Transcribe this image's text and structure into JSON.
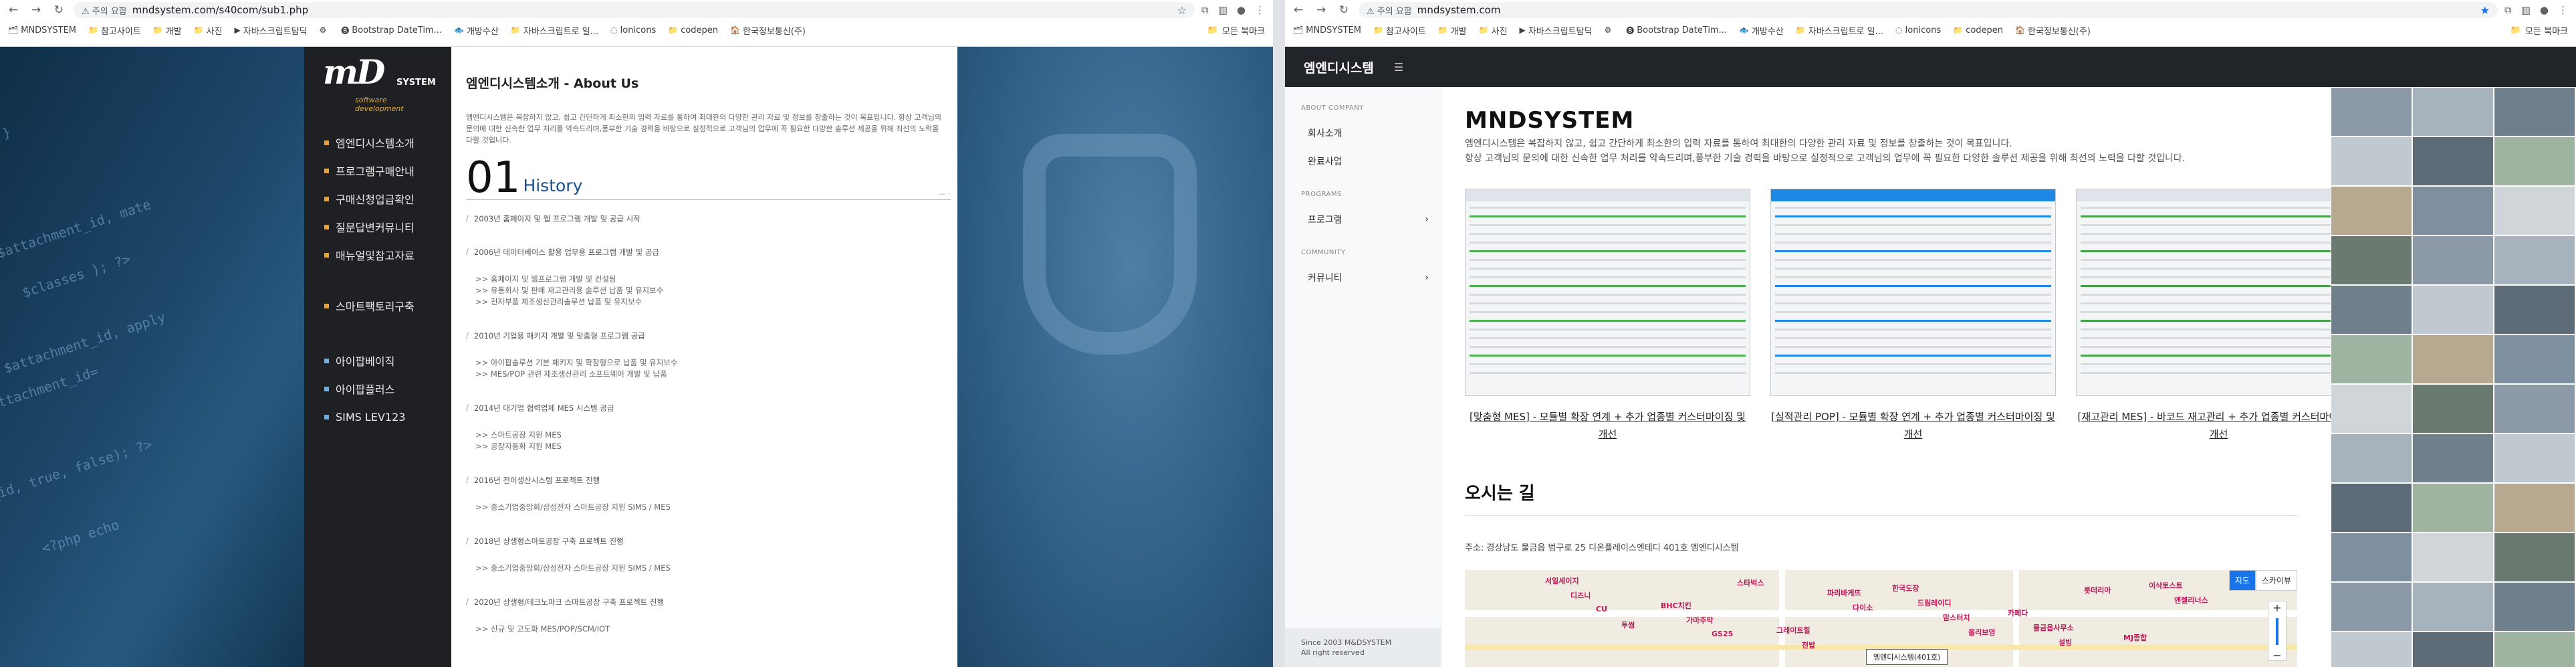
{
  "left": {
    "browser": {
      "security_label": "주의 요함",
      "url": "mndsystem.com/s40com/sub1.php",
      "bookmarks": [
        "MNDSYSTEM",
        "참고사이트",
        "개발",
        "사진",
        "자바스크립트탐딕",
        "",
        "Bootstrap DateTim...",
        "개방수산",
        "자바스크립트로 일...",
        "Ionicons",
        "codepen",
        "한국정보통신(주)"
      ],
      "bookmarks_right": "모든 북마크"
    },
    "logo": {
      "mark": "mD",
      "system": "SYSTEM",
      "tagline": "software development"
    },
    "menu": [
      "엠엔디시스템소개",
      "프로그램구매안내",
      "구매신청업급확인",
      "질문답변커뮤니티",
      "매뉴얼및참고자료"
    ],
    "menu_mid": [
      "스마트팩토리구축"
    ],
    "menu_low": [
      "아이팝베이직",
      "아이팝플러스",
      "SIMS LEV123"
    ],
    "page_title": "엠엔디시스템소개 - About Us",
    "intro": "엠엔디시스템은 복잡하지 않고, 쉽고 간단하게 최소한의 입력 자료를 통하여 최대한의 다양한 관리 자료 및 정보를 창출하는 것이 목표입니다. 항상 고객님의 문의에 대한 신속한 업무 처리를 약속드리며,풍부한 기술 경력을 바탕으로 실정적으로 고객님의 업무에 꼭 필요한 다양한 솔루션 제공을 위해 최선의 노력을 다할 것입니다.",
    "history_number": "01",
    "history_title": "History",
    "history_mark": "— ·",
    "history": [
      {
        "year": "2003년 홈페이지 및 웹 프로그램 개발 및 공급 시작",
        "items": []
      },
      {
        "year": "2006년 데이터베이스 활용 업무용 프로그램 개발 및 공급",
        "items": [
          ">> 홈페이지 및 웹프로그램 개발 및 컨설팅",
          ">> 유통회사 및 판매 재고관리용 솔루션 납품 및 유지보수",
          ">> 전자부품 제조생산관리솔루션 납품 및 유지보수"
        ]
      },
      {
        "year": "2010년 기업용 패키지 개발 및 맞춤형 프로그램 공급",
        "items": [
          ">> 아이팝솔루션 기본 패키지 및 확장형으로 납품 및 유지보수",
          ">> MES/POP 관련 제조생산관리 소프트웨어 개발 및 납품"
        ]
      },
      {
        "year": "2014년 대기업 협력업체 MES 시스템 공급",
        "items": [
          ">> 스마트공장 지원 MES",
          ">> 공장자동화 지원 MES"
        ]
      },
      {
        "year": "2016년 전이생산시스템 프로젝트 진행",
        "items": [
          ">> 중소기업중앙회/삼성전자 스마트공장 지원 SIMS / MES"
        ]
      },
      {
        "year": "2018년 상생형스마트공장 구축 프로젝트 진행",
        "items": [
          ">> 중소기업중앙회/삼성전자 스마트공장 지원 SIMS / MES"
        ]
      },
      {
        "year": "2020년 상생형/테크노파크 스마트공장 구축 프로젝트 진행",
        "items": [
          ">> 신규 및 고도화 MES/POP/SCM/IOT"
        ]
      }
    ]
  },
  "right": {
    "browser": {
      "security_label": "주의 요함",
      "url": "mndsystem.com",
      "bookmarks": [
        "MNDSYSTEM",
        "참고사이트",
        "개발",
        "사진",
        "자바스크립트탐딕",
        "",
        "Bootstrap DateTim...",
        "개방수산",
        "자바스크립트로 일...",
        "Ionicons",
        "codepen",
        "한국정보통신(주)"
      ],
      "bookmarks_right": "모든 북마크"
    },
    "brand": "엠엔디시스템",
    "sidebar": {
      "about_head": "ABOUT COMPANY",
      "about_items": [
        "회사소개",
        "완료사업"
      ],
      "programs_head": "PROGRAMS",
      "programs_items": [
        "프로그램"
      ],
      "community_head": "COMMUNITY",
      "community_items": [
        "커뮤니티"
      ],
      "footer_line1": "Since 2003 M&DSYSTEM",
      "footer_line2": "All right reserved"
    },
    "main": {
      "title": "MNDSYSTEM",
      "desc1": "엠엔디시스템은 복잡하지 않고, 쉽고 간단하게 최소한의 입력 자료를 통하여 최대한의 다양한 관리 자료 및 정보를 창출하는 것이 목표입니다.",
      "desc2": "항상 고객님의 문의에 대한 신속한 업무 처리를 약속드리며,풍부한 기술 경력을 바탕으로 실정적으로 고객님의 업무에 꼭 필요한 다양한 솔루션 제공을 위해 최선의 노력을 다할 것입니다.",
      "cards": [
        {
          "caption": "[맞춤형 MES] - 모듈별 확장 연계 + 추가 업종별 커스터마이징 및 개선"
        },
        {
          "caption": "[실적관리 POP] - 모듈별 확장 연계 + 추가 업종별 커스터마이징 및 개선"
        },
        {
          "caption": "[재고관리 MES] - 바코드 재고관리 + 추가 업종별 커스터마이징 및 개선"
        }
      ],
      "directions_title": "오시는 길",
      "address": "주소: 경상남도 물금읍 범구로 25 디온플레이스엔테디 401호 엠엔디시스템",
      "map": {
        "btn_map": "지도",
        "btn_sky": "스카이뷰",
        "pin_label": "엠엔디시스템(401호)",
        "pois": [
          "서일세이지",
          "BHC치킨",
          "그레이트힐",
          "한국도장",
          "카페다",
          "MJ종합",
          "디즈니",
          "가마주막",
          "천밥",
          "드림레이디",
          "물금읍사무소",
          "이삭토스트",
          "CU",
          "GS25",
          "파리바게뜨",
          "맘스터치",
          "설빙",
          "엔젤리너스",
          "투썸",
          "스타벅스",
          "다이소",
          "올리브영",
          "롯데리아"
        ]
      }
    }
  }
}
